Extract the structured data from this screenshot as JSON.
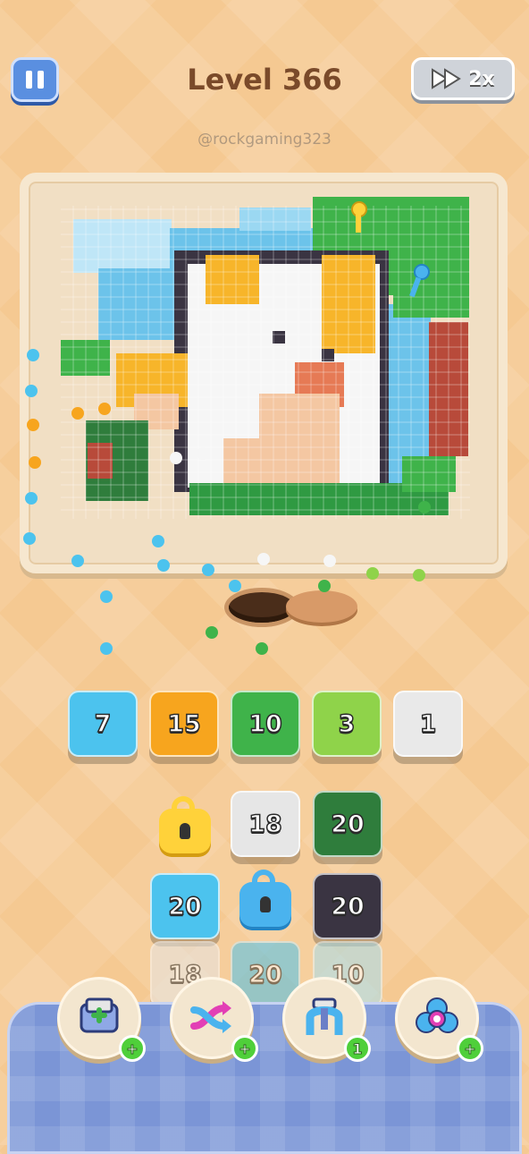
{
  "header": {
    "level_label": "Level 366",
    "speed_label": "2x",
    "watermark": "@rockgaming323"
  },
  "icons": {
    "pause": "pause-icon",
    "speed": "fast-forward-icon",
    "lock": "padlock-icon",
    "booster_add": "plus-icon"
  },
  "queue_tiles": [
    {
      "value": "7",
      "color": "#4cc3ee"
    },
    {
      "value": "15",
      "color": "#f7a51e"
    },
    {
      "value": "10",
      "color": "#3fb34a"
    },
    {
      "value": "3",
      "color": "#8fd34a"
    },
    {
      "value": "1",
      "color": "#e9e9e9"
    }
  ],
  "grid_tiles": [
    {
      "value": "18",
      "color": "#e6e6e6"
    },
    {
      "value": "20",
      "color": "#2f7d3c"
    },
    {
      "value": "20",
      "color": "#4cc3ee"
    },
    {
      "value": "20",
      "color": "#3a3442"
    },
    {
      "value": "18",
      "color": "#e6e6e6"
    },
    {
      "value": "20",
      "color": "#4cc3ee"
    },
    {
      "value": "10",
      "color": "#a7dff0"
    }
  ],
  "boosters": [
    {
      "name": "add-slot",
      "badge": "+"
    },
    {
      "name": "shuffle",
      "badge": "+"
    },
    {
      "name": "magnet",
      "badge": "1"
    },
    {
      "name": "bomb",
      "badge": "+"
    }
  ]
}
